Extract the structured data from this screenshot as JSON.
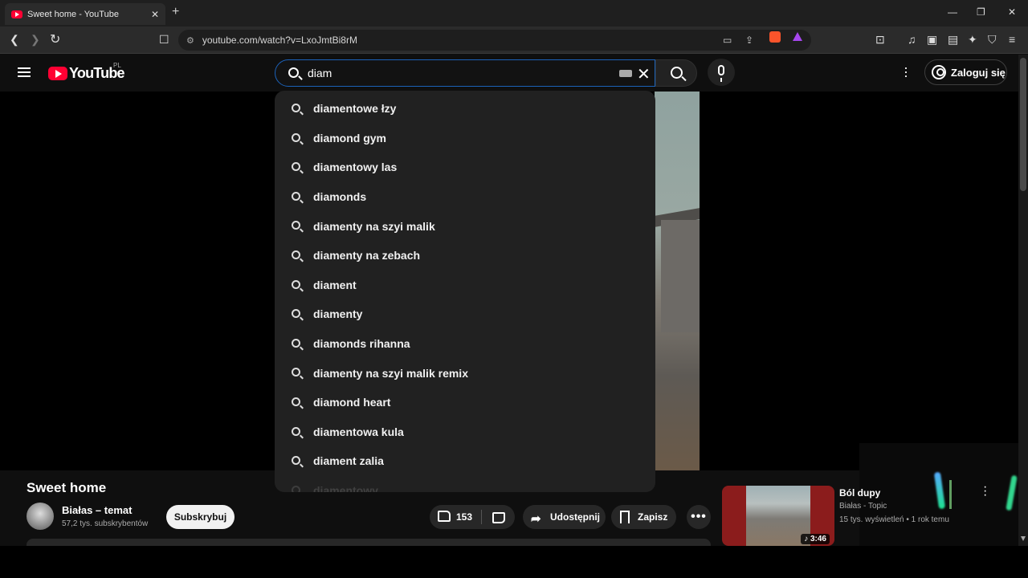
{
  "browser": {
    "tab_title": "Sweet home - YouTube",
    "tab_close": "✕",
    "new_tab": "+",
    "url": "youtube.com/watch?v=LxoJmtBi8rM",
    "site_info": "⚙",
    "window_controls": {
      "minimize": "—",
      "maximize": "❐",
      "close": "✕"
    },
    "nav": {
      "back": "❮",
      "forward": "❯",
      "reload": "↻",
      "bookmark": "☐"
    },
    "toolbar_icons": [
      "cast-icon",
      "share-icon",
      "brave-shields-icon",
      "brave-rewards-icon",
      "leo-icon",
      "media-icon",
      "sidebar-icon",
      "wallet-icon",
      "ai-icon",
      "vpn-icon",
      "menu-icon"
    ]
  },
  "header": {
    "logo_text": "YouTube",
    "country_code": "PL",
    "search_value": "diam",
    "sign_in_label": "Zaloguj się"
  },
  "suggestions": [
    "diamentowe łzy",
    "diamond gym",
    "diamentowy las",
    "diamonds",
    "diamenty na szyi malik",
    "diamenty na zebach",
    "diament",
    "diamenty",
    "diamonds rihanna",
    "diamenty na szyi malik remix",
    "diamond heart",
    "diamentowa kula",
    "diament zalia",
    "diamentowy"
  ],
  "video": {
    "title": "Sweet home",
    "channel_name": "Białas – temat",
    "subscribers": "57,2 tys. subskrybentów",
    "subscribe_label": "Subskrybuj",
    "like_count": "153",
    "share_label": "Udostępnij",
    "save_label": "Zapisz",
    "more_label": "•••"
  },
  "recommended": {
    "title": "Ból dupy",
    "channel": "Białas - Topic",
    "meta": "15 tys. wyświetleń • 1 rok temu",
    "duration": "♪ 3:46"
  }
}
